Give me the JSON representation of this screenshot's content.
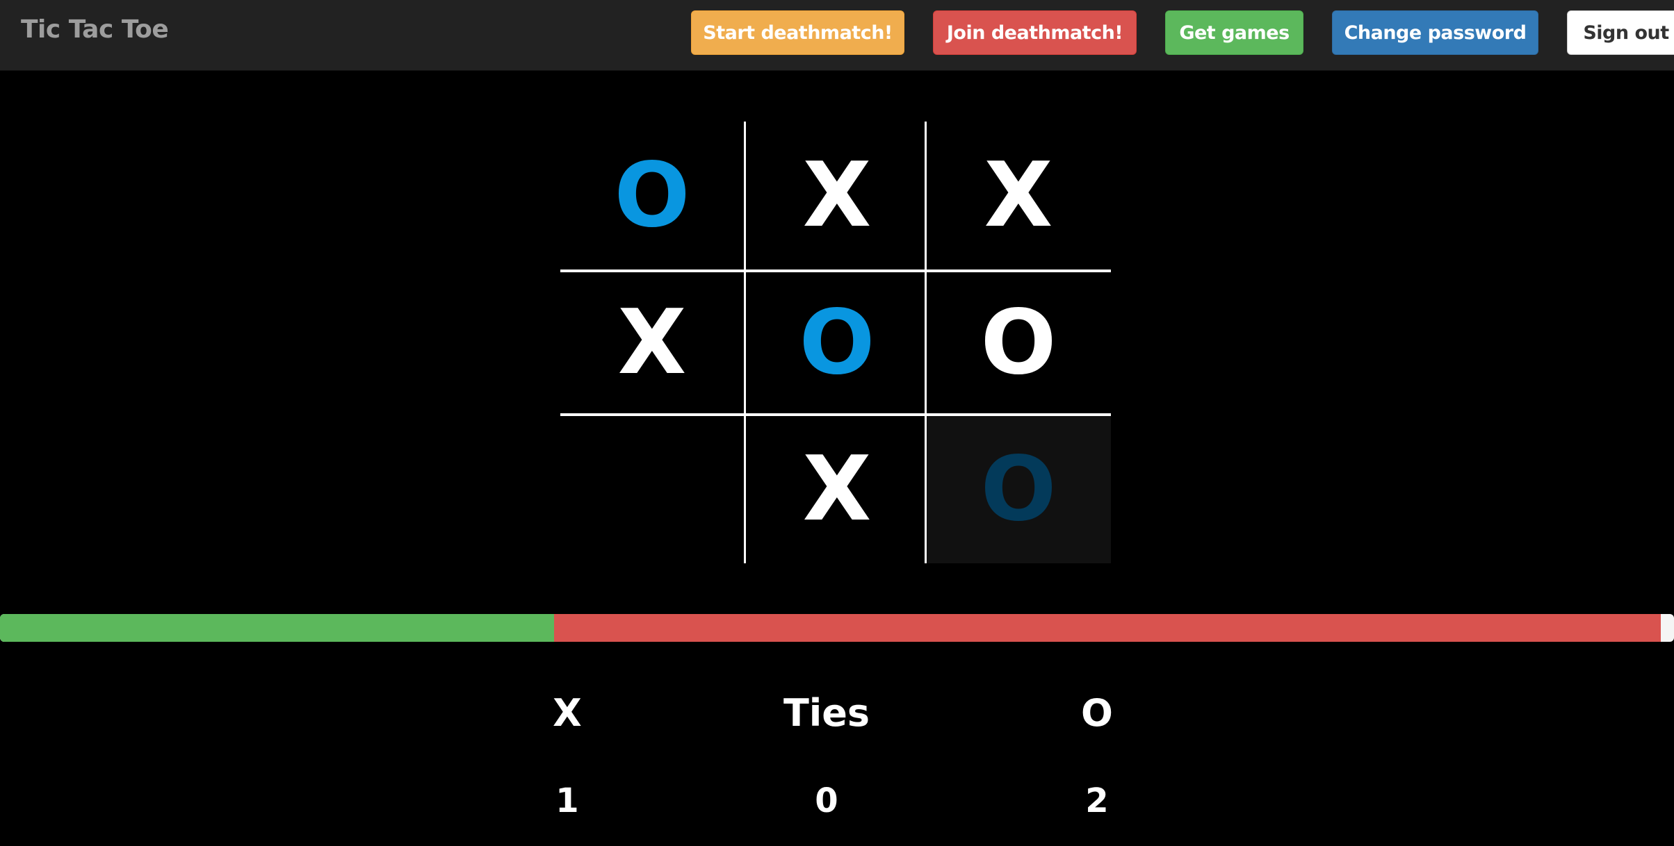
{
  "navbar": {
    "brand": "Tic Tac Toe",
    "buttons": {
      "start": "Start deathmatch!",
      "join": "Join deathmatch!",
      "games": "Get games",
      "password": "Change password",
      "signout": "Sign out"
    }
  },
  "board": {
    "cells": [
      {
        "mark": "O",
        "color": "#0996e0"
      },
      {
        "mark": "X",
        "color": "#ffffff"
      },
      {
        "mark": "X",
        "color": "#ffffff"
      },
      {
        "mark": "X",
        "color": "#ffffff"
      },
      {
        "mark": "O",
        "color": "#0996e0"
      },
      {
        "mark": "O",
        "color": "#ffffff"
      },
      {
        "mark": "",
        "color": "#ffffff"
      },
      {
        "mark": "X",
        "color": "#ffffff"
      },
      {
        "mark": "O",
        "color": "#033a5a"
      }
    ],
    "hover_cell_index": 8
  },
  "progress": {
    "x_fraction": 0.331,
    "o_fraction": 0.661,
    "x_color": "#5cb85c",
    "o_color": "#d9534f"
  },
  "scores": {
    "x_label": "X",
    "ties_label": "Ties",
    "o_label": "O",
    "x_value": "1",
    "ties_value": "0",
    "o_value": "2"
  }
}
